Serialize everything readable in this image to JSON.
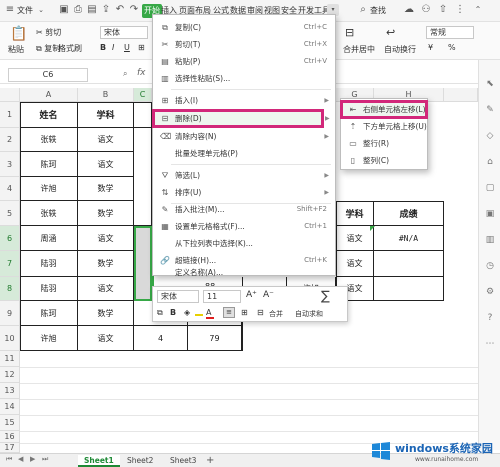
{
  "topbar": {
    "file_menu": "文件",
    "tabs": [
      "开始",
      "插入",
      "页面布局",
      "公式",
      "数据",
      "审阅",
      "视图",
      "安全",
      "开发工具"
    ],
    "search": "查找"
  },
  "ribbon": {
    "paste": "粘贴",
    "cut": "剪切",
    "copy": "复制",
    "format_painter": "格式刷",
    "font_name": "宋体",
    "merge_center": "合并居中",
    "auto_wrap": "自动换行",
    "number_format": "常规",
    "currency": "¥",
    "percent": "%"
  },
  "formula_bar": {
    "cell_ref": "C6",
    "fx": "fx"
  },
  "columns": [
    "A",
    "B",
    "C",
    "D",
    "E",
    "F",
    "G",
    "H"
  ],
  "rows": [
    "1",
    "2",
    "3",
    "4",
    "5",
    "6",
    "7",
    "8",
    "9",
    "10",
    "11",
    "12",
    "13",
    "14",
    "15",
    "16",
    "17"
  ],
  "table": {
    "headers": [
      "姓名",
      "学科"
    ],
    "rows": [
      [
        "张轶",
        "语文"
      ],
      [
        "陈珂",
        "语文"
      ],
      [
        "许旭",
        "数学"
      ],
      [
        "张轶",
        "数学"
      ],
      [
        "周涵",
        "语文"
      ],
      [
        "陆羽",
        "数学"
      ],
      [
        "陆羽",
        "语文"
      ],
      [
        "陈珂",
        "数学"
      ],
      [
        "许旭",
        "语文"
      ]
    ],
    "row10_c": "4",
    "row10_d": "79",
    "row8_d": "88"
  },
  "right_table": {
    "header_subject": "学科",
    "header_score": "成绩",
    "row6_subject": "语文",
    "row6_score": "#N/A",
    "row7_subject": "语文",
    "row8_name": "许旭",
    "row8_subject": "语文"
  },
  "context_menu": {
    "items": [
      {
        "icon": "copy-icon",
        "label": "复制(C)",
        "shortcut": "Ctrl+C"
      },
      {
        "icon": "cut-icon",
        "label": "剪切(T)",
        "shortcut": "Ctrl+X"
      },
      {
        "icon": "paste-icon",
        "label": "粘贴(P)",
        "shortcut": "Ctrl+V"
      },
      {
        "icon": "paste-special-icon",
        "label": "选择性粘贴(S)...",
        "shortcut": ""
      },
      {
        "icon": "insert-icon",
        "label": "插入(I)",
        "shortcut": ""
      },
      {
        "icon": "delete-icon",
        "label": "删除(D)",
        "shortcut": ""
      },
      {
        "icon": "clear-icon",
        "label": "清除内容(N)",
        "shortcut": ""
      },
      {
        "icon": "batch-icon",
        "label": "批量处理单元格(P)",
        "shortcut": ""
      },
      {
        "icon": "filter-icon",
        "label": "筛选(L)",
        "shortcut": ""
      },
      {
        "icon": "sort-icon",
        "label": "排序(U)",
        "shortcut": ""
      },
      {
        "icon": "comment-icon",
        "label": "插入批注(M)...",
        "shortcut": "Shift+F2"
      },
      {
        "icon": "format-cells-icon",
        "label": "设置单元格格式(F)...",
        "shortcut": "Ctrl+1"
      },
      {
        "icon": "dropdown-list-icon",
        "label": "从下拉列表中选择(K)...",
        "shortcut": ""
      },
      {
        "icon": "hyperlink-icon",
        "label": "超链接(H)...",
        "shortcut": "Ctrl+K"
      },
      {
        "icon": "define-name-icon",
        "label": "定义名称(A)...",
        "shortcut": ""
      }
    ]
  },
  "submenu": {
    "items": [
      "右侧单元格左移(L)",
      "下方单元格上移(U)",
      "整行(R)",
      "整列(C)"
    ]
  },
  "mini_toolbar": {
    "font": "宋体",
    "size": "11",
    "merge": "合并",
    "autosum": "自动求和"
  },
  "sheet_tabs": [
    "Sheet1",
    "Sheet2",
    "Sheet3"
  ],
  "add_sheet": "+",
  "watermark": {
    "brand": "windows系统家园",
    "url": "www.runaihome.com"
  },
  "colors": {
    "accent_green": "#37a847",
    "highlight_pink": "#d2287a"
  }
}
